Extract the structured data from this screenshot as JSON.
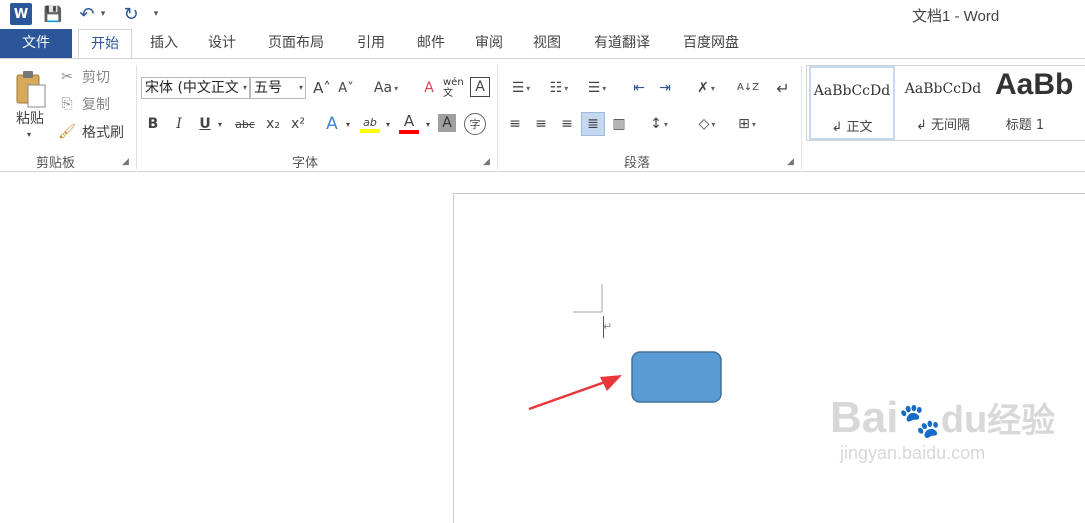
{
  "window": {
    "title": "文档1 - Word"
  },
  "qat": {
    "app_icon": "W",
    "save": "💾",
    "undo": "↶",
    "undo_caret": "▾",
    "redo": "↻",
    "customize": "▾"
  },
  "tabs": [
    "文件",
    "开始",
    "插入",
    "设计",
    "页面布局",
    "引用",
    "邮件",
    "审阅",
    "视图",
    "有道翻译",
    "百度网盘"
  ],
  "clipboard": {
    "paste": "粘贴",
    "paste_caret": "▾",
    "cut": "剪切",
    "copy": "复制",
    "format_painter": "格式刷",
    "label": "剪贴板"
  },
  "font": {
    "name": "宋体 (中文正文",
    "size": "五号",
    "grow": "A˄",
    "shrink": "A˅",
    "case": "Aa",
    "clear": "A",
    "phonetic": "wén 文",
    "border": "A",
    "bold": "B",
    "italic": "I",
    "underline": "U",
    "strike": "abc",
    "sub": "x₂",
    "sup": "x²",
    "effects": "A",
    "highlight": "ab",
    "color": "A",
    "shade": "A",
    "enclose": "字",
    "label": "字体"
  },
  "paragraph": {
    "label": "段落",
    "sort": "A↓Z",
    "marks": "↵"
  },
  "styles": [
    {
      "sample": "AaBbCcDd",
      "name": "↲ 正文"
    },
    {
      "sample": "AaBbCcDd",
      "name": "↲ 无间隔"
    },
    {
      "sample": "AaBb",
      "name": "标题 1"
    }
  ],
  "document": {
    "para_mark": "↵"
  },
  "watermark": {
    "brand": "Bai",
    "paw": "🐾",
    "brand2": "du",
    "jingyan": "经验",
    "url": "jingyan.baidu.com"
  },
  "colors": {
    "accent": "#2b579a",
    "shape_fill": "#5b9bd5",
    "shape_stroke": "#41719c",
    "arrow": "#e8363a",
    "highlight": "#ffff00",
    "font_red": "#ff0000"
  }
}
